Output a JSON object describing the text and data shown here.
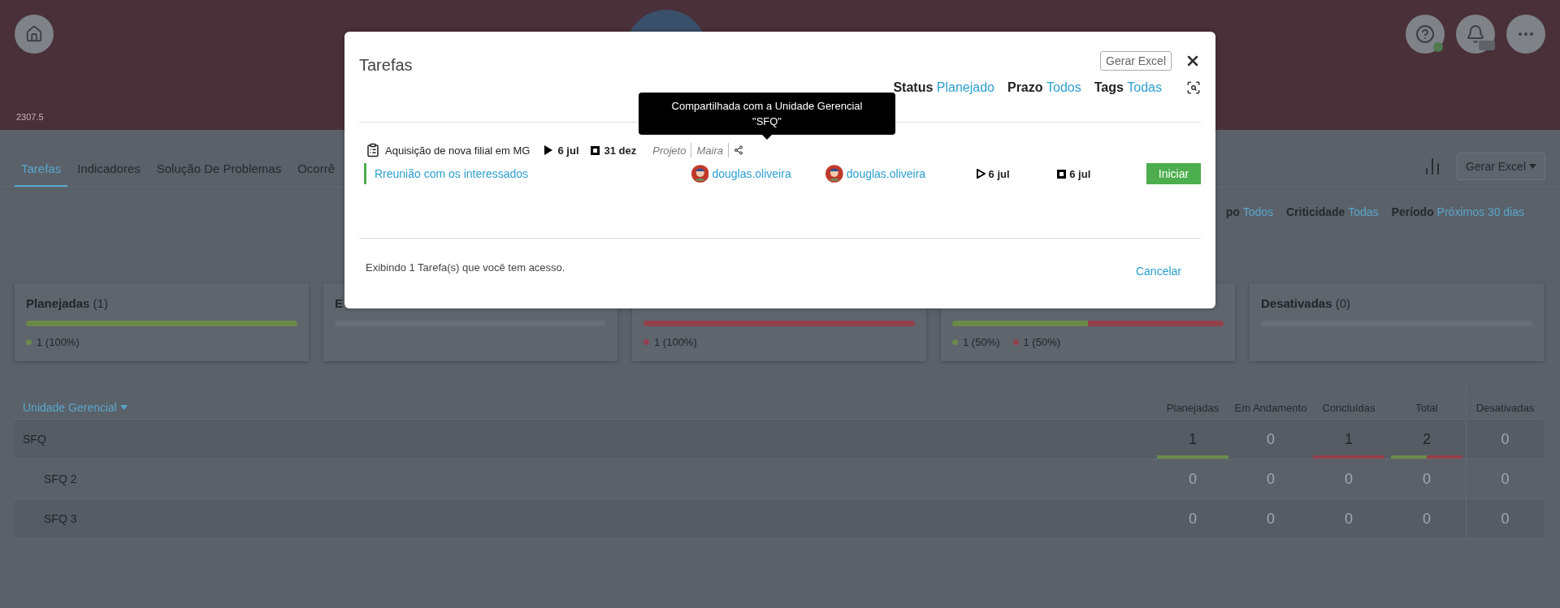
{
  "header": {
    "version": "2307.5"
  },
  "page_tabs": [
    {
      "label": "Tarefas",
      "selected": true
    },
    {
      "label": "Indicadores",
      "selected": false
    },
    {
      "label": "Solução De Problemas",
      "selected": false
    },
    {
      "label": "Ocorrê",
      "selected": false
    }
  ],
  "toolbar": {
    "excel_button": "Gerar Excel"
  },
  "filters": [
    {
      "label": "po",
      "value": "Todos"
    },
    {
      "label": "Criticidade",
      "value": "Todas"
    },
    {
      "label": "Período",
      "value": "Próximos 30 dias"
    }
  ],
  "cards": [
    {
      "title": "Planejadas",
      "count": "(1)",
      "segments": [
        {
          "color": "#6b8a4a",
          "level": 1
        }
      ],
      "legend": [
        {
          "color": "#6b8a4a",
          "text": "1 (100%)"
        }
      ]
    },
    {
      "title": "E"
    },
    {
      "segments": [
        {
          "color": "#94404c",
          "level": 1
        }
      ],
      "legend": [
        {
          "color": "#94404c",
          "text": "1 (100%)"
        }
      ]
    },
    {
      "segments": [
        {
          "color": "#6b8a4a",
          "level": 0.5
        },
        {
          "color": "#94404c",
          "level": 0.5
        }
      ],
      "legend": [
        {
          "color": "#6b8a4a",
          "text": "1 (50%)"
        },
        {
          "color": "#94404c",
          "text": "1 (50%)"
        }
      ]
    },
    {
      "title": "Desativadas",
      "count": "(0)"
    }
  ],
  "table": {
    "first_column": "Unidade Gerencial",
    "columns": [
      "Planejadas",
      "Em Andamento",
      "Concluídas",
      "Total",
      "Desativadas"
    ],
    "rows": [
      {
        "name": "SFQ",
        "cells": [
          {
            "value": "1",
            "segments": [
              {
                "color": "#6b8a4a",
                "level": 1
              }
            ]
          },
          {
            "value": "0"
          },
          {
            "value": "1",
            "segments": [
              {
                "color": "#94404c",
                "level": 1
              }
            ]
          },
          {
            "value": "2",
            "segments": [
              {
                "color": "#6b8a4a",
                "level": 0.5
              },
              {
                "color": "#94404c",
                "level": 0.5
              }
            ]
          },
          {
            "value": "0"
          }
        ],
        "children": [
          {
            "name": "SFQ 2",
            "cells": [
              {
                "value": "0"
              },
              {
                "value": "0"
              },
              {
                "value": "0"
              },
              {
                "value": "0"
              },
              {
                "value": "0"
              }
            ]
          },
          {
            "name": "SFQ 3",
            "cells": [
              {
                "value": "0"
              },
              {
                "value": "0"
              },
              {
                "value": "0"
              },
              {
                "value": "0"
              },
              {
                "value": "0"
              }
            ]
          }
        ]
      }
    ]
  },
  "modal": {
    "title": "Tarefas",
    "excel_button": "Gerar Excel",
    "filters": [
      {
        "label": "Status",
        "value": "Planejado"
      },
      {
        "label": "Prazo",
        "value": "Todos"
      },
      {
        "label": "Tags",
        "value": "Todas"
      }
    ],
    "project": {
      "name": "Aquisição de nova filial em MG",
      "start": "6 jul",
      "end": "31 dez",
      "type": "Projeto",
      "owner": "Maira"
    },
    "tooltip": [
      "Compartilhada com a Unidade Gerencial",
      "\"SFQ\""
    ],
    "tasks": [
      {
        "title": "Rreunião com os interessados",
        "responsible": "douglas.oliveira",
        "author": "douglas.oliveira",
        "start": "6 jul",
        "end": "6 jul",
        "action": "Iniciar"
      }
    ],
    "summary": "Exibindo 1 Tarefa(s) que você tem acesso.",
    "cancel": "Cancelar"
  }
}
